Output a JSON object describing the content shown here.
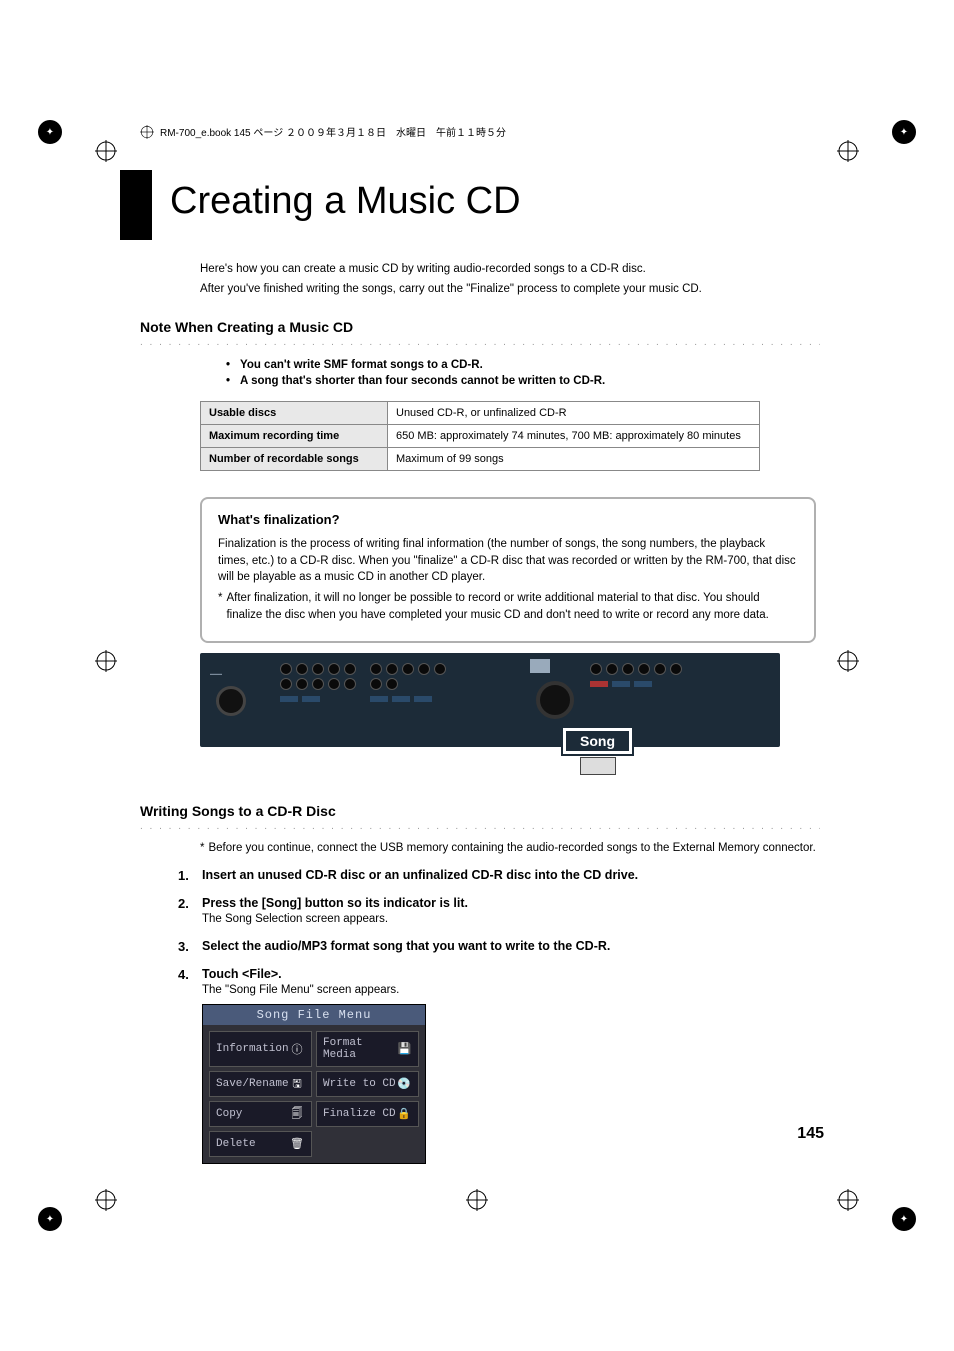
{
  "meta_header": "RM-700_e.book 145 ページ ２００９年３月１８日　水曜日　午前１１時５分",
  "page_title": "Creating a Music CD",
  "intro_p1": "Here's how you can create a music CD by writing audio-recorded songs to a CD-R disc.",
  "intro_p2": "After you've finished writing the songs, carry out the \"Finalize\" process to complete your music CD.",
  "section1_title": "Note When Creating a Music CD",
  "bullets": {
    "b1": "You can't write SMF format songs to a CD-R.",
    "b2": "A song that's shorter than four seconds cannot be written to CD-R."
  },
  "spec_table": {
    "r1_h": "Usable discs",
    "r1_v": "Unused CD-R, or unfinalized CD-R",
    "r2_h": "Maximum recording time",
    "r2_v": "650 MB: approximately 74 minutes, 700 MB: approximately 80 minutes",
    "r3_h": "Number of recordable songs",
    "r3_v": "Maximum of 99 songs"
  },
  "finalization": {
    "title": "What's finalization?",
    "p1": "Finalization is the process of writing final information (the number of songs, the song numbers, the playback times, etc.) to a CD-R disc. When you \"finalize\" a CD-R disc that was recorded or written by the RM-700, that disc will be playable as a music CD in another CD player.",
    "p2_ast": "*",
    "p2": "After finalization, it will no longer be possible to record or write additional material to that disc. You should finalize the disc when you have completed your music CD and don't need to write or record any more data."
  },
  "song_callout": "Song",
  "section2_title": "Writing Songs to a CD-R Disc",
  "pre_note_ast": "*",
  "pre_note": "Before you continue, connect the USB memory containing the audio-recorded songs to the External Memory connector.",
  "steps": {
    "s1_head": "Insert an unused CD-R disc or an unfinalized CD-R disc into the CD drive.",
    "s2_head": "Press the [Song] button so its indicator is lit.",
    "s2_body": "The Song Selection screen appears.",
    "s3_head": "Select the audio/MP3 format song that you want to write to the CD-R.",
    "s4_head": "Touch <File>.",
    "s4_body": "The \"Song File Menu\" screen appears."
  },
  "menu": {
    "title": "Song File Menu",
    "items": {
      "information": "Information",
      "format_media": "Format Media",
      "save_rename": "Save/Rename",
      "write_to_cd": "Write to CD",
      "copy": "Copy",
      "finalize_cd": "Finalize CD",
      "delete": "Delete"
    },
    "icons": {
      "information": "info-icon",
      "format_media": "floppy-icon",
      "save_rename": "save-icon",
      "write_to_cd": "disc-write-icon",
      "copy": "copy-icon",
      "finalize_cd": "disc-lock-icon",
      "delete": "trash-icon"
    }
  },
  "page_number": "145"
}
